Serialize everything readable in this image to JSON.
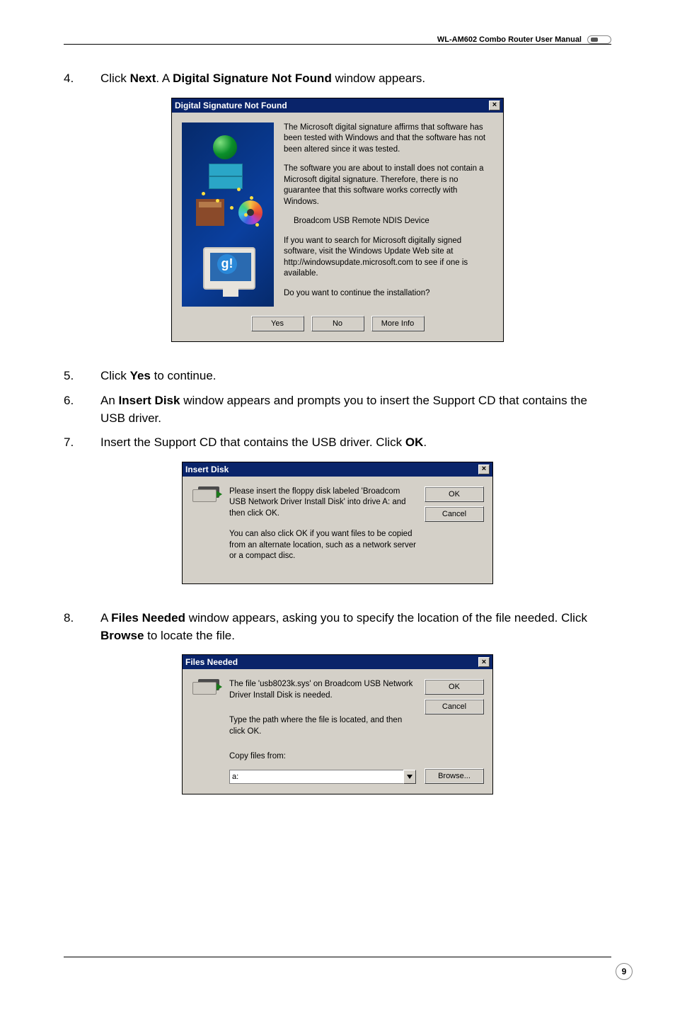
{
  "header": {
    "manual_title": "WL-AM602 Combo Router User Manual"
  },
  "steps": {
    "s4": {
      "num": "4.",
      "pre": "Click ",
      "b1": "Next",
      "mid": ". A ",
      "b2": "Digital Signature Not Found",
      "post": " window appears."
    },
    "s5": {
      "num": "5.",
      "pre": "Click ",
      "b1": "Yes",
      "post": " to continue."
    },
    "s6": {
      "num": "6.",
      "pre": "An ",
      "b1": "Insert Disk",
      "post": " window appears and prompts you to insert the Support CD that contains the USB driver."
    },
    "s7": {
      "num": "7.",
      "text": "Insert the Support CD that contains the USB driver. Click ",
      "b1": "OK",
      "post": "."
    },
    "s8": {
      "num": "8.",
      "pre": "A ",
      "b1": "Files Needed",
      "mid": " window appears, asking you to specify the location of the file needed. Click ",
      "b2": "Browse",
      "post": " to locate the file."
    }
  },
  "dsig": {
    "title": "Digital Signature Not Found",
    "p1": "The Microsoft digital signature affirms that software has been tested with Windows and that the software has not been altered since it was tested.",
    "p2": "The software you are about to install does not contain a Microsoft digital signature. Therefore, there is no guarantee that this software works correctly with Windows.",
    "device": "Broadcom USB Remote NDIS Device",
    "p3": "If you want to search for Microsoft digitally signed software, visit the Windows Update Web site at http://windowsupdate.microsoft.com to see if one is available.",
    "p4": "Do you want to continue the installation?",
    "btn_yes": "Yes",
    "btn_no": "No",
    "btn_more": "More Info"
  },
  "insert_disk": {
    "title": "Insert Disk",
    "p1": "Please insert the floppy disk labeled 'Broadcom USB Network Driver Install Disk' into drive A: and then click OK.",
    "p2": "You can also click OK if you want files to be copied from an alternate location, such as a network server or a compact disc.",
    "btn_ok": "OK",
    "btn_cancel": "Cancel"
  },
  "files_needed": {
    "title": "Files Needed",
    "p1": "The file 'usb8023k.sys' on Broadcom USB Network Driver Install Disk is needed.",
    "p2": "Type the path where the file is located, and then click OK.",
    "label": "Copy files from:",
    "value": "a:",
    "btn_ok": "OK",
    "btn_cancel": "Cancel",
    "btn_browse": "Browse..."
  },
  "page_number": "9"
}
